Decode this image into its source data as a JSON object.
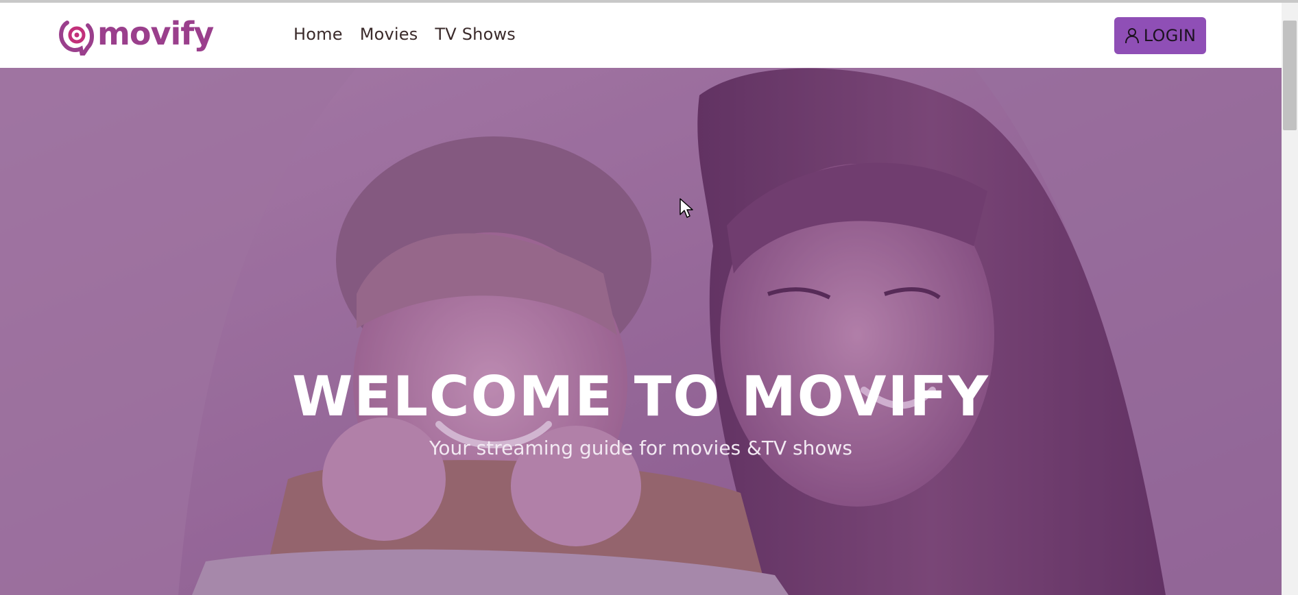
{
  "brand": {
    "name": "movify",
    "color": "#9a3f8c"
  },
  "nav": {
    "items": [
      "Home",
      "Movies",
      "TV Shows"
    ]
  },
  "login": {
    "label": "LOGIN",
    "icon": "user-icon",
    "color": "#8f4fb6"
  },
  "hero": {
    "title": "WELCOME TO MOVIFY",
    "subtitle": "Your streaming guide for movies &TV shows",
    "overlay_color": "#8b4f8f"
  }
}
